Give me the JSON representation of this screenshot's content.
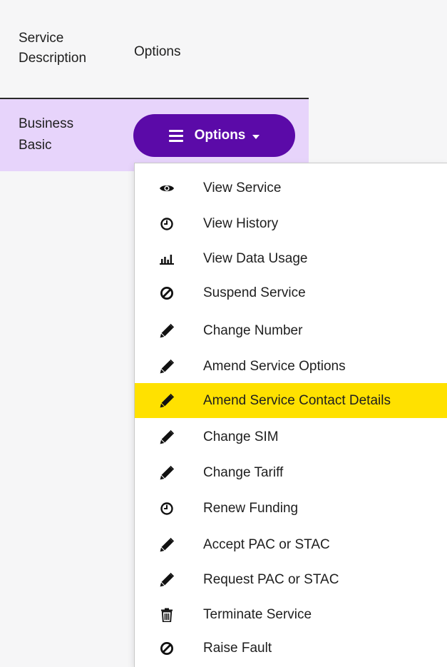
{
  "table": {
    "headers": {
      "service_description": "Service Description",
      "options": "Options"
    },
    "row": {
      "service_description": "Business Basic",
      "options_button_label": "Options"
    }
  },
  "dropdown": {
    "highlight_color": "#ffe100",
    "items": [
      {
        "label": "View Service",
        "icon": "eye-icon"
      },
      {
        "label": "View History",
        "icon": "clock-icon"
      },
      {
        "label": "View Data Usage",
        "icon": "bar-chart-icon"
      },
      {
        "label": "Suspend Service",
        "icon": "ban-icon"
      },
      {
        "label": "Change Number",
        "icon": "pencil-icon"
      },
      {
        "label": "Amend Service Options",
        "icon": "pencil-icon"
      },
      {
        "label": "Amend Service Contact Details",
        "icon": "pencil-icon",
        "active": true
      },
      {
        "label": "Change SIM",
        "icon": "pencil-icon"
      },
      {
        "label": "Change Tariff",
        "icon": "pencil-icon"
      },
      {
        "label": "Renew Funding",
        "icon": "clock-icon"
      },
      {
        "label": "Accept PAC or STAC",
        "icon": "pencil-icon"
      },
      {
        "label": "Request PAC or STAC",
        "icon": "pencil-icon"
      },
      {
        "label": "Terminate Service",
        "icon": "trash-icon"
      },
      {
        "label": "Raise Fault",
        "icon": "ban-icon"
      }
    ]
  },
  "colors": {
    "background": "#f6f6f7",
    "row_selected": "#e7d4fb",
    "button": "#5b0aa8"
  }
}
